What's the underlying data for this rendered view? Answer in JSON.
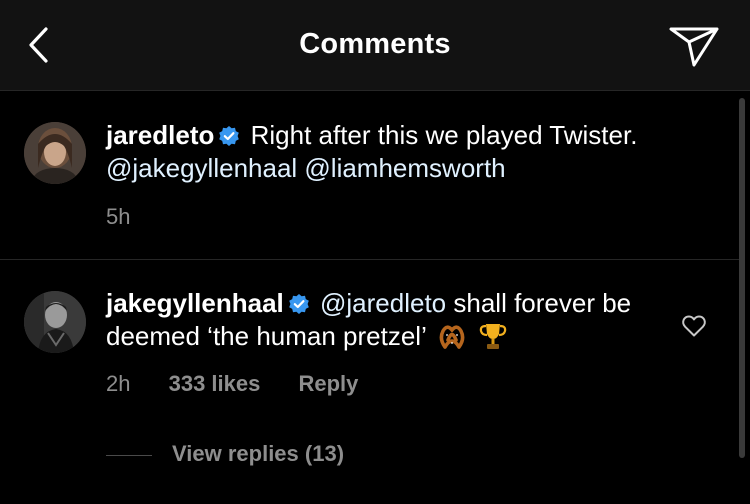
{
  "header": {
    "title": "Comments"
  },
  "comments": [
    {
      "username": "jaredleto",
      "verified": true,
      "text": "Right after this we played Twister.",
      "mentions": "@jakegyllenhaal @liamhemsworth",
      "time": "5h"
    },
    {
      "username": "jakegyllenhaal",
      "verified": true,
      "mention": "@jaredleto",
      "text": "shall forever be deemed ‘the human pretzel’",
      "emojis": [
        "pretzel-icon",
        "trophy-icon"
      ],
      "time": "2h",
      "likes": "333 likes",
      "reply_label": "Reply",
      "view_replies": "View replies (13)"
    }
  ],
  "colors": {
    "background": "#000000",
    "header_bg": "#121212",
    "meta_text": "#8e8e8e",
    "verified_blue": "#3897f0",
    "mention": "#e0f1ff"
  }
}
